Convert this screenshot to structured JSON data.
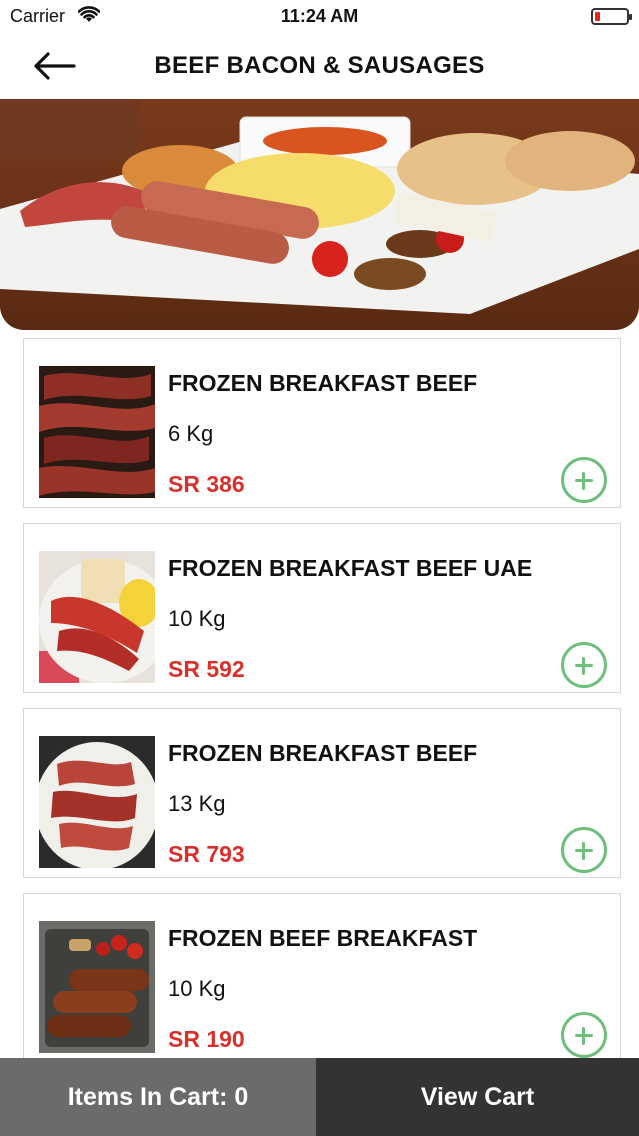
{
  "status_bar": {
    "carrier": "Carrier",
    "time": "11:24 AM",
    "icons": [
      "wifi-icon",
      "battery-low-icon"
    ],
    "battery_color": "#e3261c"
  },
  "header": {
    "title": "BEEF BACON & SAUSAGES",
    "back_icon": "arrow-left-icon"
  },
  "hero": {
    "image": "breakfast-plate-photo"
  },
  "products": [
    {
      "name": "FROZEN BREAKFAST BEEF",
      "weight": "6 Kg",
      "price": "SR 386",
      "image": "bacon-strips-photo"
    },
    {
      "name": "FROZEN BREAKFAST BEEF UAE",
      "weight": "10 Kg",
      "price": "SR 592",
      "image": "bacon-plate-eggs-photo"
    },
    {
      "name": "FROZEN BREAKFAST BEEF",
      "weight": "13 Kg",
      "price": "SR 793",
      "image": "bacon-plate-photo"
    },
    {
      "name": "FROZEN BEEF BREAKFAST",
      "weight": "10 Kg",
      "price": "SR 190",
      "image": "sausages-tray-photo"
    }
  ],
  "bottom_bar": {
    "cart_label": "Items In Cart: 0",
    "view_cart_label": "View Cart"
  },
  "colors": {
    "price": "#d8312b",
    "add_button": "#6dbf7b",
    "cart_bar": "#6b6b6b",
    "view_cart_bar": "#333333"
  }
}
